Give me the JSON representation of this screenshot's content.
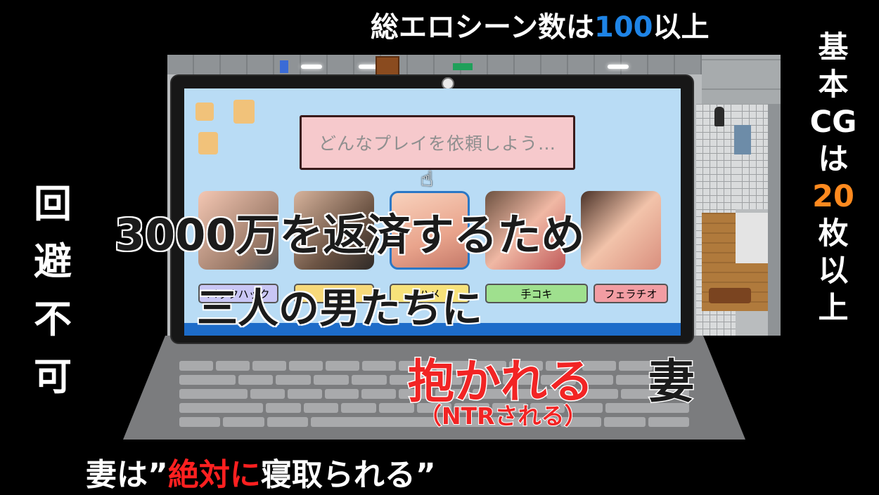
{
  "captions": {
    "total_scenes_prefix": "総エロシーン数は",
    "total_scenes_number": "100",
    "total_scenes_suffix": "以上",
    "cg_line_1": "基",
    "cg_line_2": "本",
    "cg_line_3": "CG",
    "cg_line_4": "は",
    "cg_number": "20",
    "cg_line_6": "枚",
    "cg_line_7": "以",
    "cg_line_8": "上",
    "unavoidable_1": "回",
    "unavoidable_2": "避",
    "unavoidable_3": "不",
    "unavoidable_4": "可",
    "headline_1": "3000万を返済するため",
    "headline_2": "三人の男たちに",
    "embraced": "抱かれる",
    "wife": "妻",
    "ntr_sub": "（NTRされる）",
    "bottom_prefix": "妻は”",
    "bottom_red": "絶対に",
    "bottom_suffix": "寝取られる”"
  },
  "screen": {
    "prompt": "どんなプレイを依頼しよう…",
    "play_options": [
      {
        "label": "バックハック",
        "color": "#c9c6f5"
      },
      {
        "label": "アナ",
        "color": "#f7d97a"
      },
      {
        "label": "ハメ",
        "color": "#f7e27a"
      },
      {
        "label": "手コキ",
        "color": "#9fe08e"
      },
      {
        "label": "フェラチオ",
        "color": "#f29da3"
      }
    ]
  },
  "colors": {
    "accent_blue": "#1e84e6",
    "accent_orange": "#ff8a1f",
    "accent_red": "#f22424"
  }
}
